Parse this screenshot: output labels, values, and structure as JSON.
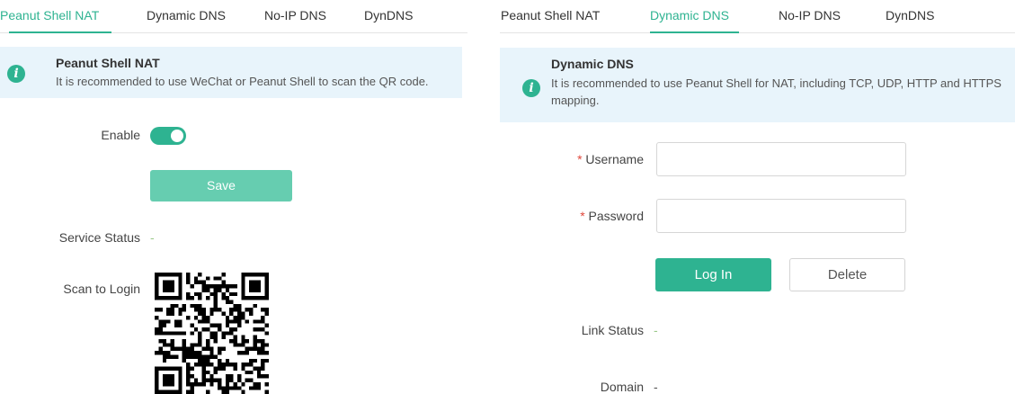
{
  "left": {
    "tabs": [
      "Peanut Shell NAT",
      "Dynamic DNS",
      "No-IP DNS",
      "DynDNS"
    ],
    "notice": {
      "title": "Peanut Shell NAT",
      "text": "It is recommended to use WeChat or Peanut Shell to scan the QR code."
    },
    "enable_label": "Enable",
    "enable_on": true,
    "save_label": "Save",
    "service_status_label": "Service Status",
    "service_status_value": "-",
    "scan_label": "Scan to Login"
  },
  "right": {
    "tabs": [
      "Peanut Shell NAT",
      "Dynamic DNS",
      "No-IP DNS",
      "DynDNS"
    ],
    "notice": {
      "title": "Dynamic DNS",
      "text": "It is recommended to use Peanut Shell for NAT, including TCP, UDP, HTTP and HTTPS mapping."
    },
    "required_mark": "*",
    "username_label": "Username",
    "username_value": "",
    "password_label": "Password",
    "password_value": "",
    "login_label": "Log In",
    "delete_label": "Delete",
    "link_status_label": "Link Status",
    "link_status_value": "-",
    "domain_label": "Domain",
    "domain_value": "-"
  },
  "colors": {
    "accent": "#2eb391",
    "save_button": "#66cdb0",
    "notice_bg": "#e8f4fb",
    "status_dash": "#9bc98a"
  },
  "icons": [
    "info-icon",
    "toggle-switch",
    "qr-code"
  ]
}
